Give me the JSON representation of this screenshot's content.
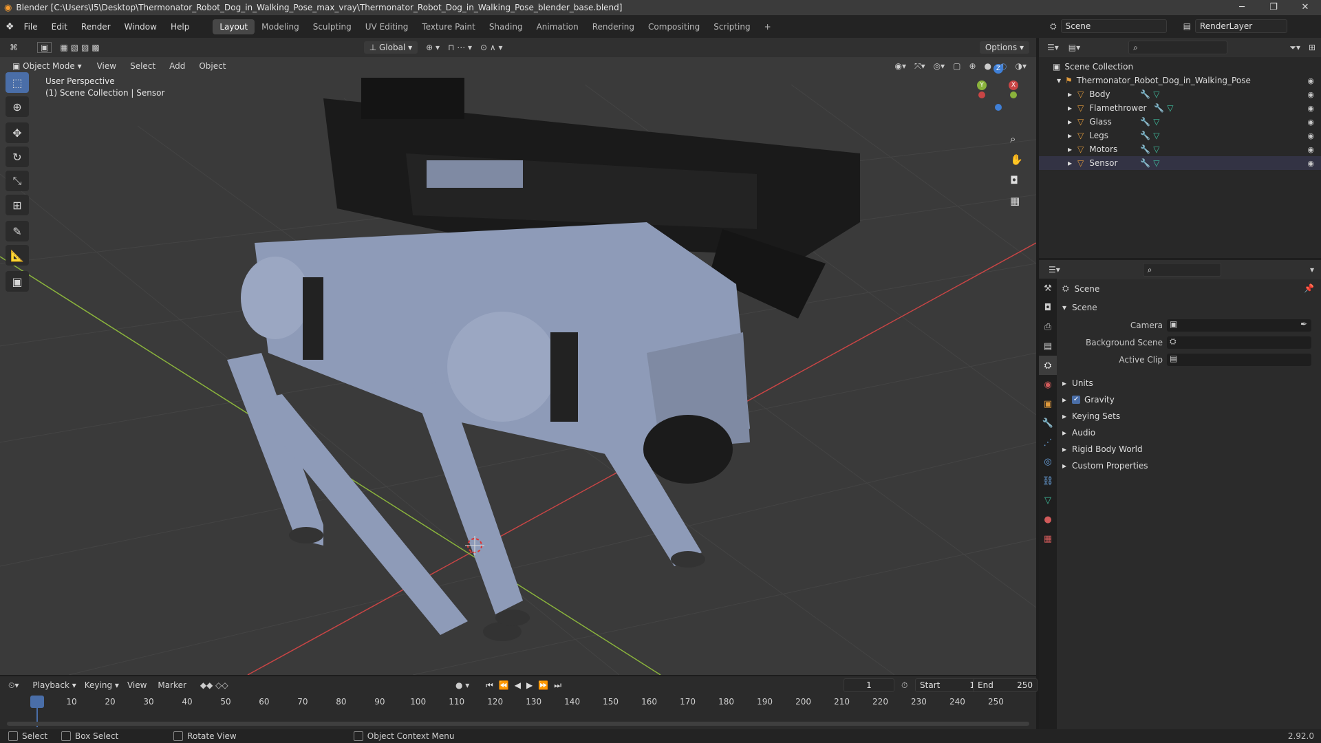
{
  "window": {
    "title": "Blender [C:\\Users\\I5\\Desktop\\Thermonator_Robot_Dog_in_Walking_Pose_max_vray\\Thermonator_Robot_Dog_in_Walking_Pose_blender_base.blend]",
    "minimize": "─",
    "maximize": "❐",
    "close": "✕"
  },
  "menu": [
    "File",
    "Edit",
    "Render",
    "Window",
    "Help"
  ],
  "workspaces": [
    "Layout",
    "Modeling",
    "Sculpting",
    "UV Editing",
    "Texture Paint",
    "Shading",
    "Animation",
    "Rendering",
    "Compositing",
    "Scripting"
  ],
  "active_workspace": "Layout",
  "add_workspace": "+",
  "scene_selector": {
    "value": "Scene"
  },
  "render_layer": {
    "value": "RenderLayer"
  },
  "viewport_header": {
    "transform_orientation": "Global",
    "options_label": "Options",
    "mode": "Object Mode",
    "view_menu": [
      "View",
      "Select",
      "Add",
      "Object"
    ]
  },
  "viewport": {
    "perspective_label": "User Perspective",
    "collection_label": "(1) Scene Collection | Sensor",
    "gizmo": {
      "z": "Z",
      "y": "Y",
      "x": "X"
    }
  },
  "outliner": {
    "root": "Scene Collection",
    "collection": "Thermonator_Robot_Dog_in_Walking_Pose",
    "objects": [
      "Body",
      "Flamethrower",
      "Glass",
      "Legs",
      "Motors",
      "Sensor"
    ]
  },
  "properties": {
    "context": "Scene",
    "section": "Scene",
    "fields": [
      {
        "label": "Camera",
        "value": ""
      },
      {
        "label": "Background Scene",
        "value": ""
      },
      {
        "label": "Active Clip",
        "value": ""
      }
    ],
    "panels": [
      "Units",
      "Gravity",
      "Keying Sets",
      "Audio",
      "Rigid Body World",
      "Custom Properties"
    ],
    "gravity_checked": true
  },
  "timeline": {
    "menus": [
      "Playback",
      "Keying",
      "View",
      "Marker"
    ],
    "current_frame": "1",
    "start_label": "Start",
    "start": "1",
    "end_label": "End",
    "end": "250",
    "ruler": [
      "1",
      "10",
      "20",
      "30",
      "40",
      "50",
      "60",
      "70",
      "80",
      "90",
      "100",
      "110",
      "120",
      "130",
      "140",
      "150",
      "160",
      "170",
      "180",
      "190",
      "200",
      "210",
      "220",
      "230",
      "240",
      "250"
    ]
  },
  "statusbar": {
    "items": [
      "Select",
      "Box Select",
      "Rotate View",
      "Object Context Menu"
    ],
    "version": "2.92.0"
  },
  "colors": {
    "accent": "#4a6ea8",
    "x_axis": "#c94545",
    "y_axis": "#8ab33c",
    "z_axis": "#3f7fd6",
    "robot_body": "#8e9bb8",
    "viewport_bg": "#3a3a3a"
  }
}
